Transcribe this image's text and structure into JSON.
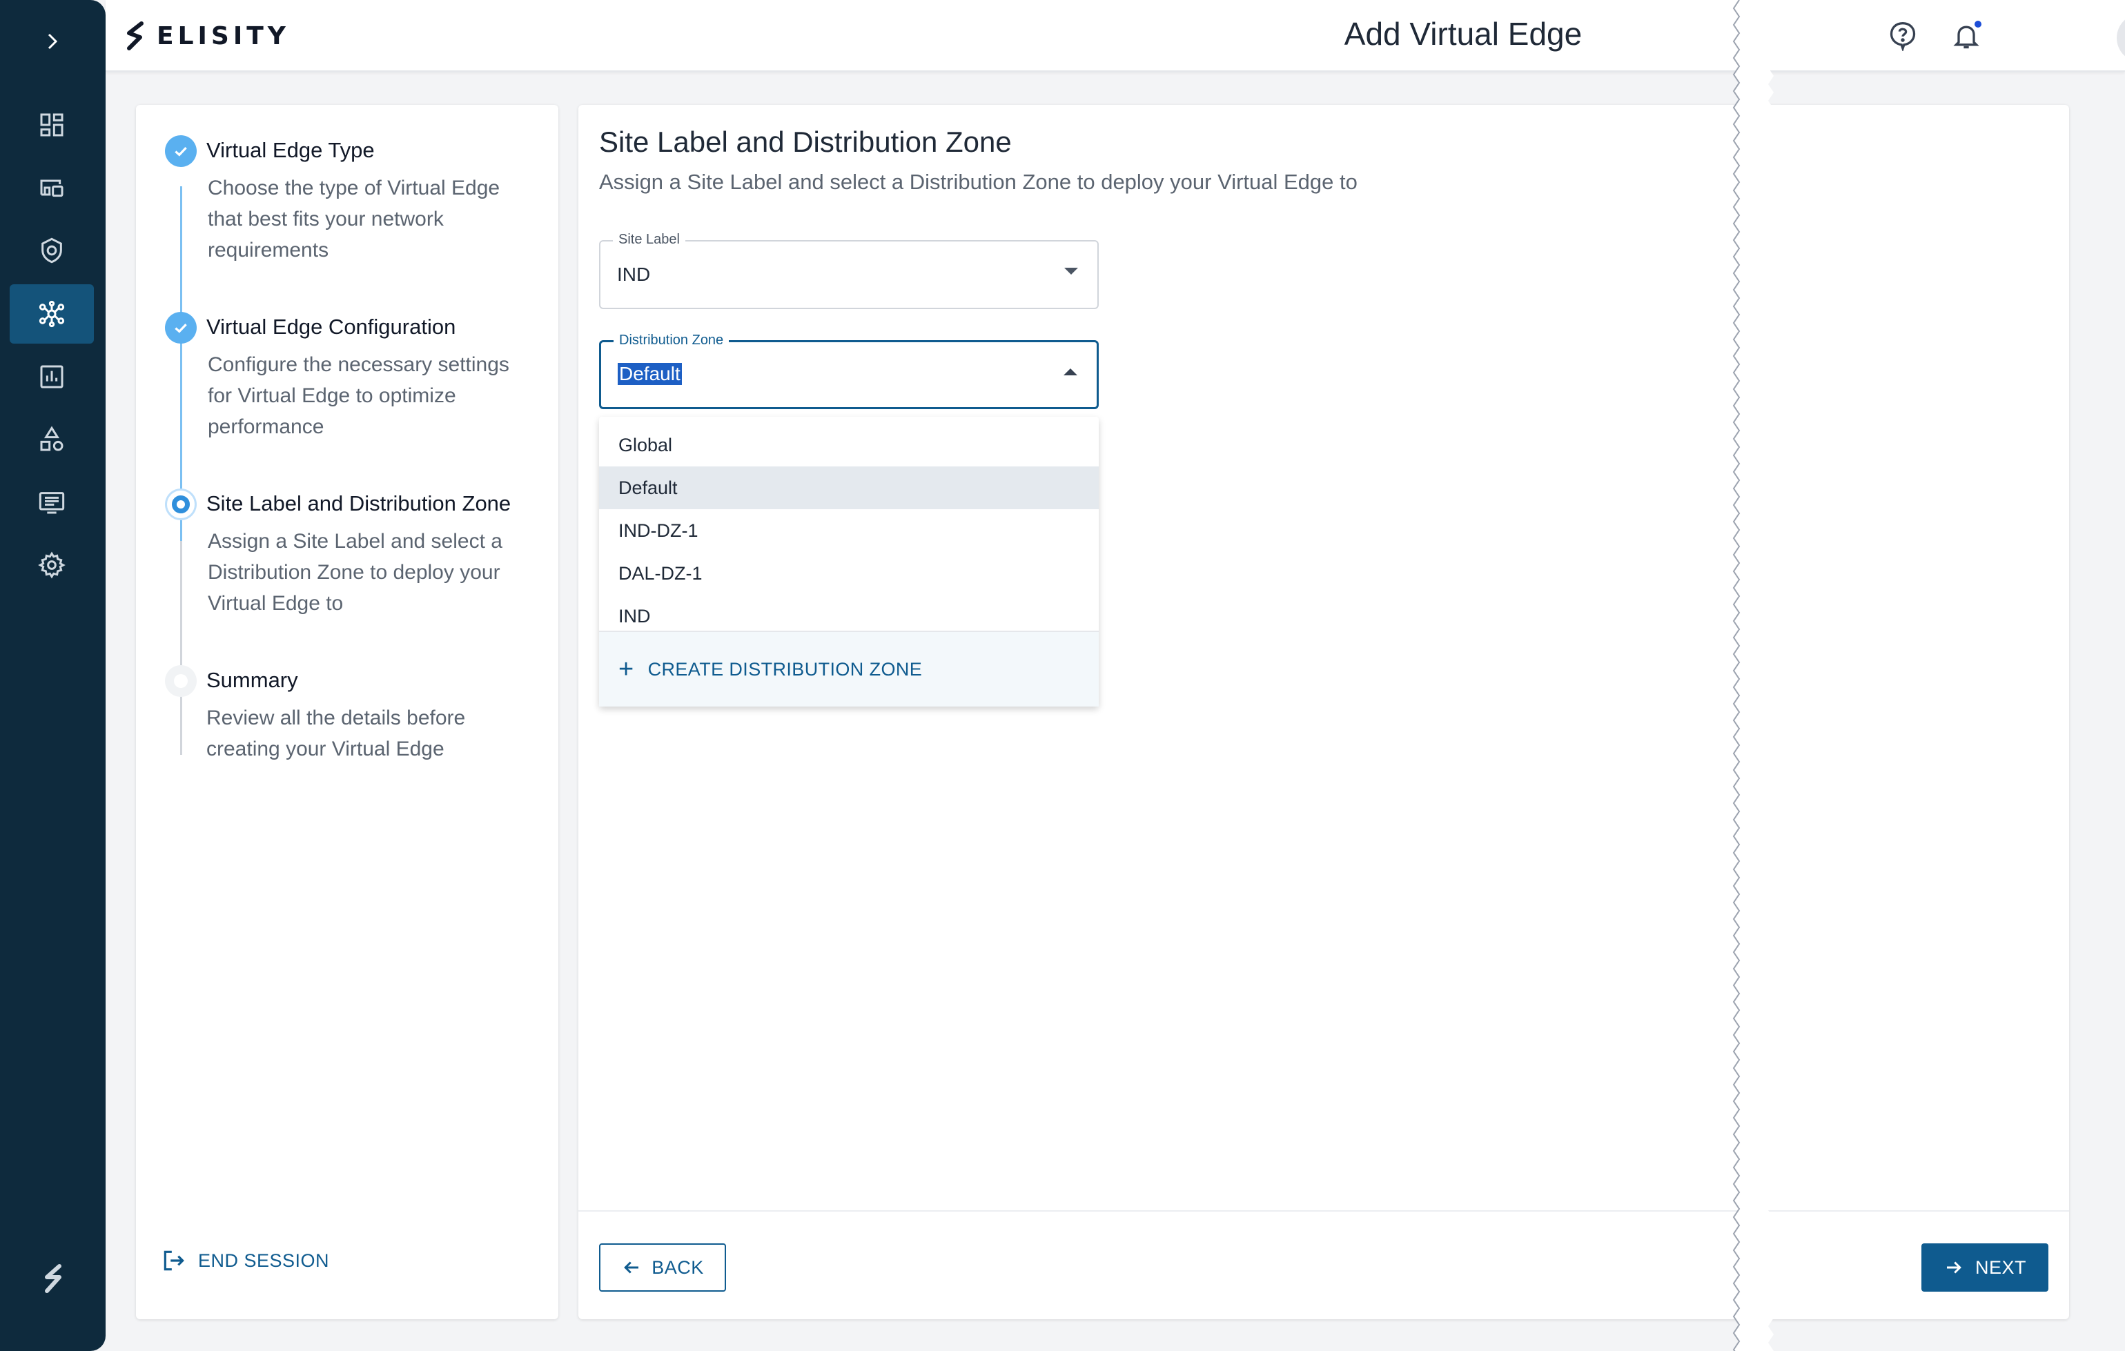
{
  "app": {
    "brand": "ELISITY",
    "page_title": "Add Virtual Edge",
    "accent_color": "#0f5b8f",
    "nav_bg": "#0e2a3d"
  },
  "leftnav": {
    "items": [
      {
        "icon": "dashboard-icon"
      },
      {
        "icon": "devices-icon"
      },
      {
        "icon": "shield-icon"
      },
      {
        "icon": "network-topology-icon",
        "active": true
      },
      {
        "icon": "analytics-icon"
      },
      {
        "icon": "shapes-icon"
      },
      {
        "icon": "logs-icon"
      },
      {
        "icon": "settings-gear-icon"
      }
    ]
  },
  "stepper": {
    "steps": [
      {
        "title": "Virtual Edge Type",
        "description": "Choose the type of Virtual Edge that best fits your network requirements",
        "state": "done"
      },
      {
        "title": "Virtual Edge Configuration",
        "description": "Configure the necessary settings for Virtual Edge to optimize performance",
        "state": "done"
      },
      {
        "title": "Site Label and Distribution Zone",
        "description": "Assign a Site Label and select a Distribution Zone to deploy your Virtual Edge to",
        "state": "current"
      },
      {
        "title": "Summary",
        "description": "Review all the details before creating your Virtual Edge",
        "state": "todo"
      }
    ],
    "end_session_label": "END SESSION"
  },
  "main": {
    "heading": "Site Label and Distribution Zone",
    "subheading": "Assign a Site Label and select a Distribution Zone to deploy your Virtual Edge to",
    "site_label": {
      "label": "Site Label",
      "value": "IND"
    },
    "distribution_zone": {
      "label": "Distribution Zone",
      "value": "Default"
    },
    "dropdown_options": [
      "Global",
      "Default",
      "IND-DZ-1",
      "DAL-DZ-1",
      "IND"
    ],
    "highlighted_option": "Default",
    "create_label": "CREATE DISTRIBUTION ZONE",
    "back_label": "BACK",
    "next_label": "NEXT"
  }
}
